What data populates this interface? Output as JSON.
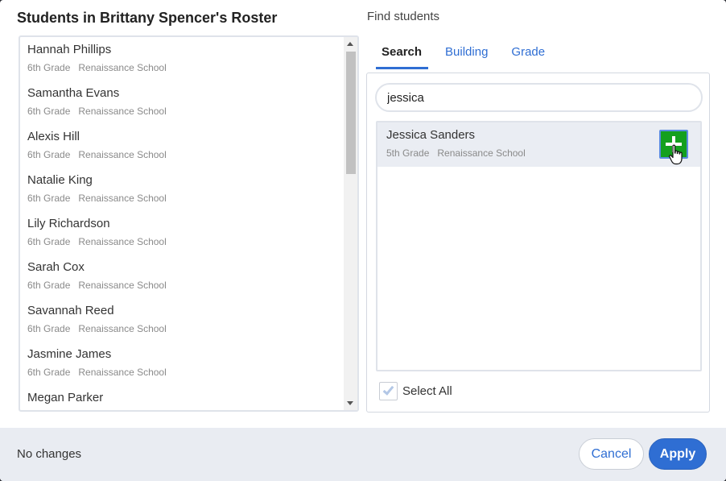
{
  "roster": {
    "title": "Students in Brittany Spencer's Roster",
    "students": [
      {
        "name": "Hannah Phillips",
        "grade": "6th Grade",
        "school": "Renaissance School"
      },
      {
        "name": "Samantha Evans",
        "grade": "6th Grade",
        "school": "Renaissance School"
      },
      {
        "name": "Alexis Hill",
        "grade": "6th Grade",
        "school": "Renaissance School"
      },
      {
        "name": "Natalie King",
        "grade": "6th Grade",
        "school": "Renaissance School"
      },
      {
        "name": "Lily Richardson",
        "grade": "6th Grade",
        "school": "Renaissance School"
      },
      {
        "name": "Sarah Cox",
        "grade": "6th Grade",
        "school": "Renaissance School"
      },
      {
        "name": "Savannah Reed",
        "grade": "6th Grade",
        "school": "Renaissance School"
      },
      {
        "name": "Jasmine James",
        "grade": "6th Grade",
        "school": "Renaissance School"
      },
      {
        "name": "Megan Parker",
        "grade": "",
        "school": ""
      }
    ]
  },
  "find": {
    "title": "Find students",
    "tabs": [
      {
        "label": "Search",
        "active": true
      },
      {
        "label": "Building",
        "active": false
      },
      {
        "label": "Grade",
        "active": false
      }
    ],
    "search_value": "jessica",
    "results": [
      {
        "name": "Jessica Sanders",
        "grade": "5th Grade",
        "school": "Renaissance School"
      }
    ],
    "select_all_label": "Select All",
    "add_icon": "plus-icon"
  },
  "footer": {
    "status": "No changes",
    "cancel_label": "Cancel",
    "apply_label": "Apply"
  },
  "colors": {
    "accent": "#2f6ed3",
    "add_button": "#14a01e",
    "footer_bg": "#e9ecf2"
  }
}
